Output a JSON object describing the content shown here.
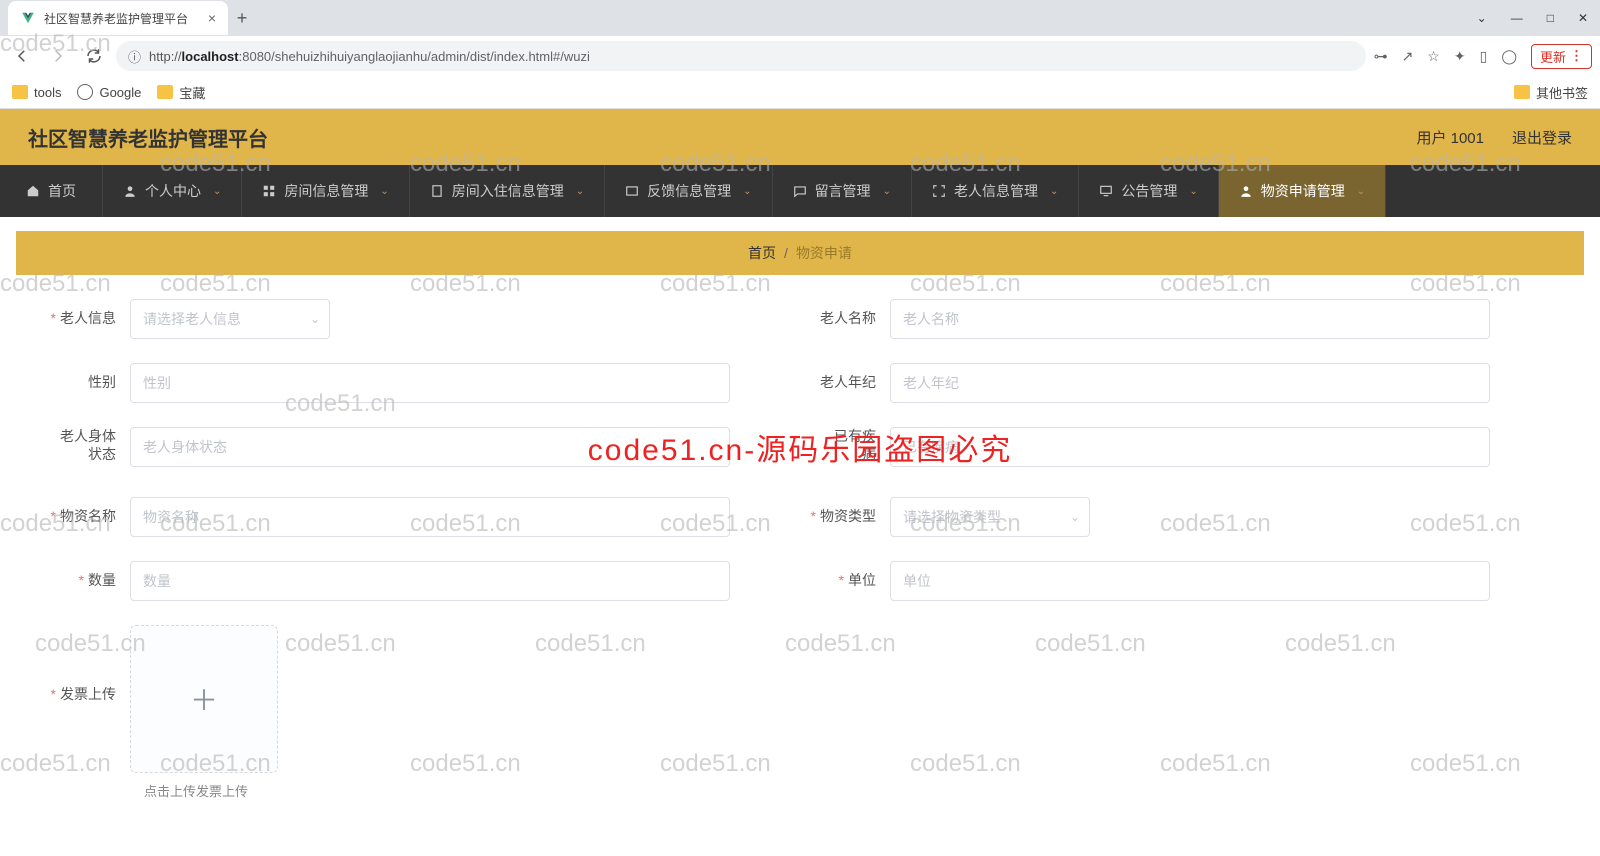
{
  "browser": {
    "tab_title": "社区智慧养老监护管理平台",
    "url_host": "localhost",
    "url_port": ":8080",
    "url_path": "/shehuizhihuiyanglaojianhu/admin/dist/index.html#/wuzi",
    "url_proto": "http://",
    "update_label": "更新",
    "bookmarks": {
      "tools": "tools",
      "google": "Google",
      "treasure": "宝藏",
      "other": "其他书签"
    }
  },
  "header": {
    "title": "社区智慧养老监护管理平台",
    "user_label": "用户 1001",
    "logout": "退出登录"
  },
  "nav": {
    "home": "首页",
    "personal": "个人中心",
    "room_info": "房间信息管理",
    "room_checkin": "房间入住信息管理",
    "feedback": "反馈信息管理",
    "message": "留言管理",
    "elderly_info": "老人信息管理",
    "notice": "公告管理",
    "material": "物资申请管理"
  },
  "breadcrumb": {
    "home": "首页",
    "sep": "/",
    "current": "物资申请"
  },
  "form": {
    "elderly_info": {
      "label": "老人信息",
      "placeholder": "请选择老人信息"
    },
    "elderly_name": {
      "label": "老人名称",
      "placeholder": "老人名称"
    },
    "gender": {
      "label": "性别",
      "placeholder": "性别"
    },
    "elderly_age": {
      "label": "老人年纪",
      "placeholder": "老人年纪"
    },
    "body_status": {
      "label_l1": "老人身体",
      "label_l2": "状态",
      "placeholder": "老人身体状态"
    },
    "disease": {
      "label_l1": "已有疾",
      "label_l2": "病",
      "placeholder": "已有疾病"
    },
    "material_name": {
      "label": "物资名称",
      "placeholder": "物资名称"
    },
    "material_type": {
      "label": "物资类型",
      "placeholder": "请选择物资类型"
    },
    "quantity": {
      "label": "数量",
      "placeholder": "数量"
    },
    "unit": {
      "label": "单位",
      "placeholder": "单位"
    },
    "invoice": {
      "label": "发票上传",
      "tip": "点击上传发票上传"
    }
  },
  "watermark": "code51.cn",
  "watermark_red": "code51.cn-源码乐园盗图必究"
}
